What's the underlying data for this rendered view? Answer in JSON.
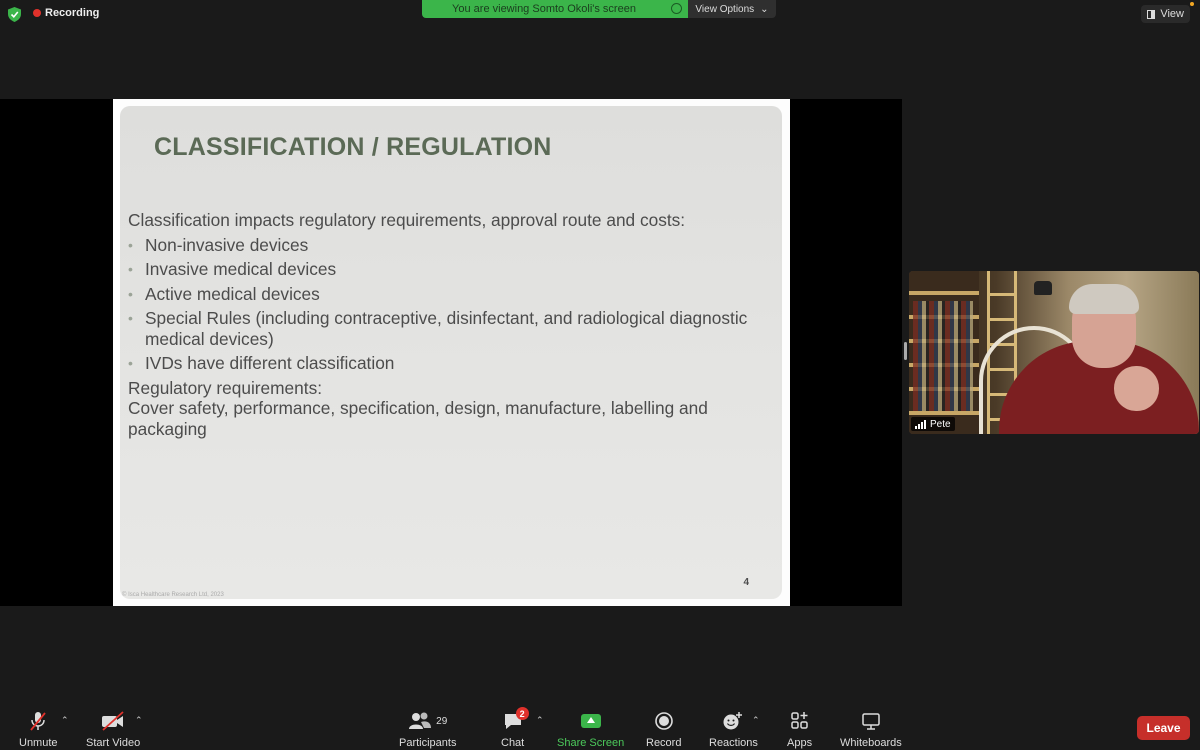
{
  "top_bar": {
    "recording_label": "Recording",
    "banner_text": "You are viewing Somto Okoli's screen",
    "view_options_label": "View Options",
    "view_label": "View"
  },
  "slide": {
    "title": "CLASSIFICATION / REGULATION",
    "intro": "Classification impacts regulatory requirements, approval route and costs:",
    "bullets": [
      "Non-invasive devices",
      "Invasive medical devices",
      "Active medical devices",
      "Special Rules (including contraceptive, disinfectant, and radiological diagnostic medical devices)",
      "IVDs have different classification"
    ],
    "reg_heading": "Regulatory requirements:",
    "reg_text": "Cover safety, performance, specification, design, manufacture, labelling and packaging",
    "page_number": "4",
    "copyright": "© Isca Healthcare Research Ltd, 2023"
  },
  "participant_video": {
    "name": "Pete"
  },
  "toolbar": {
    "unmute_label": "Unmute",
    "start_video_label": "Start Video",
    "participants_label": "Participants",
    "participants_count": "29",
    "chat_label": "Chat",
    "chat_badge": "2",
    "share_screen_label": "Share Screen",
    "record_label": "Record",
    "reactions_label": "Reactions",
    "apps_label": "Apps",
    "whiteboards_label": "Whiteboards",
    "leave_label": "Leave"
  },
  "colors": {
    "accent_green": "#3bb54a",
    "leave_red": "#c62f2a",
    "recording_red": "#e0312b",
    "slide_title": "#5b6a56"
  }
}
